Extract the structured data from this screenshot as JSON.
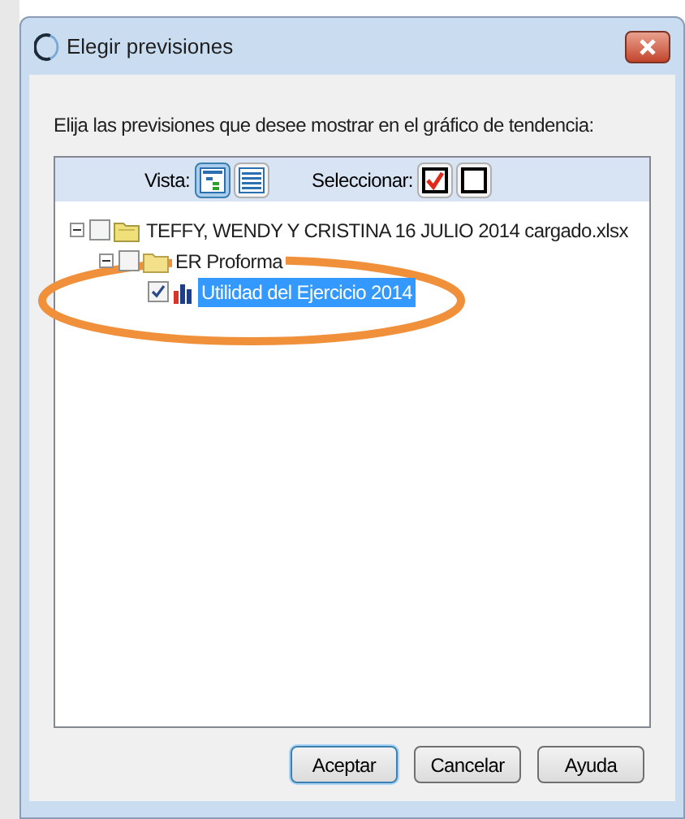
{
  "window": {
    "title": "Elegir previsiones"
  },
  "instruction": "Elija las previsiones que desee mostrar en el gráfico de tendencia:",
  "toolbar": {
    "view_label": "Vista:",
    "view_modes": [
      {
        "kind": "tree",
        "selected": true
      },
      {
        "kind": "list",
        "selected": false
      }
    ],
    "select_label": "Seleccionar:",
    "select_buttons": [
      {
        "kind": "all"
      },
      {
        "kind": "none"
      }
    ]
  },
  "tree": [
    {
      "kind": "file",
      "label": "TEFFY, WENDY Y CRISTINA 16 JULIO 2014 cargado.xlsx",
      "checked": false,
      "expanded": true,
      "selected": false,
      "children": [
        {
          "kind": "folder",
          "label": "ER Proforma",
          "checked": false,
          "expanded": true,
          "selected": false,
          "children": [
            {
              "kind": "chart",
              "label": "Utilidad del Ejercicio 2014",
              "checked": true,
              "selected": true
            }
          ]
        }
      ]
    }
  ],
  "buttons": [
    {
      "label": "Aceptar",
      "default": true
    },
    {
      "label": "Cancelar",
      "default": false
    },
    {
      "label": "Ayuda",
      "default": false
    }
  ]
}
